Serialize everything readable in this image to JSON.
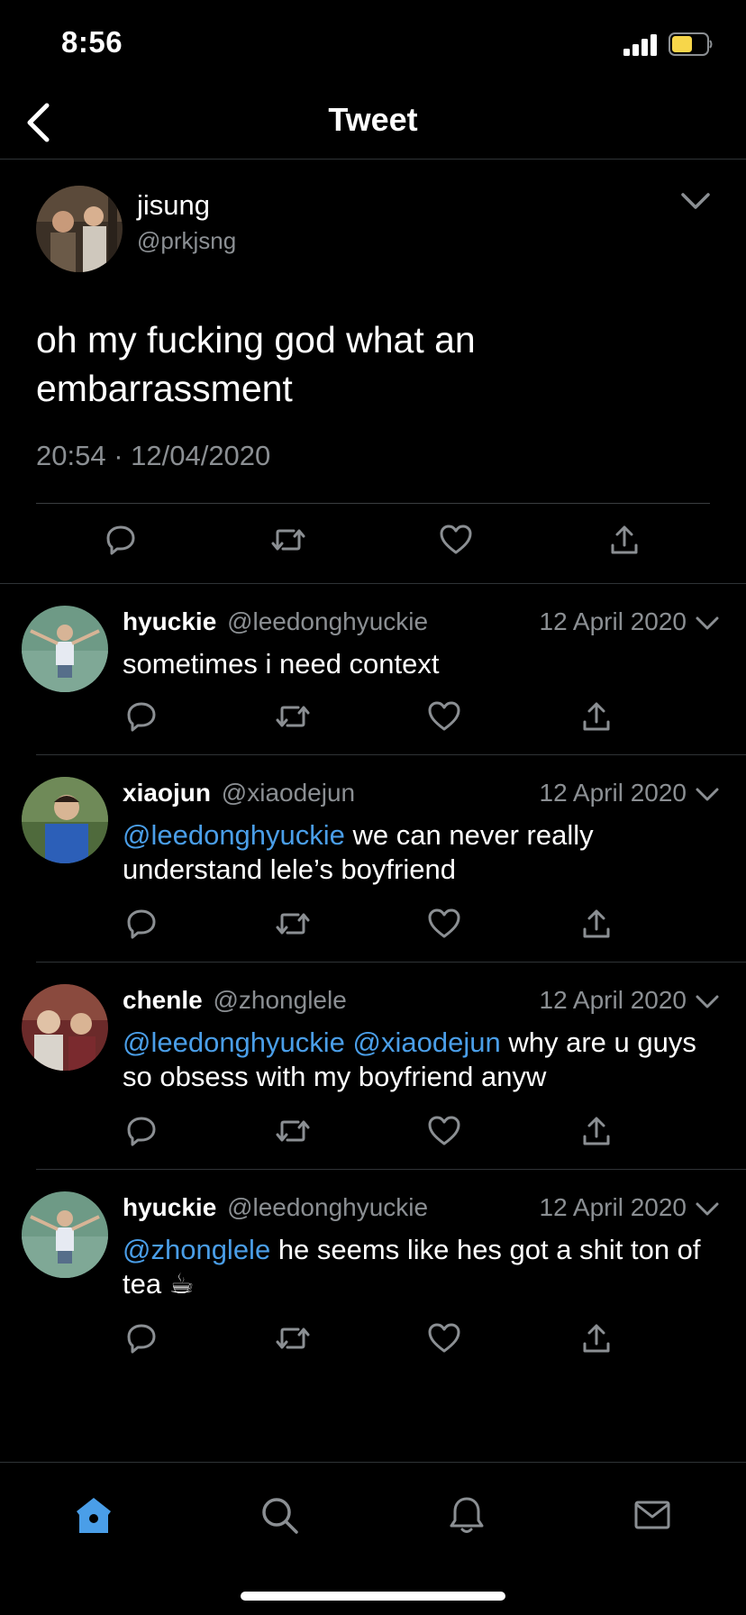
{
  "status_bar": {
    "time": "8:56"
  },
  "nav": {
    "title": "Tweet"
  },
  "main_tweet": {
    "name": "jisung",
    "handle": "@prkjsng",
    "text": "oh my fucking god what an embarrassment",
    "timestamp": "20:54 · 12/04/2020"
  },
  "replies": [
    {
      "name": "hyuckie",
      "handle": "@leedonghyuckie",
      "date": "12 April 2020",
      "mentions": "",
      "text": "sometimes i need context"
    },
    {
      "name": "xiaojun",
      "handle": "@xiaodejun",
      "date": "12 April 2020",
      "mentions": "@leedonghyuckie",
      "text": " we can never really understand lele’s boyfriend"
    },
    {
      "name": "chenle",
      "handle": "@zhonglele",
      "date": "12 April 2020",
      "mentions": "@leedonghyuckie @xiaodejun",
      "text": " why are u guys so obsess with my boyfriend anyw"
    },
    {
      "name": "hyuckie",
      "handle": "@leedonghyuckie",
      "date": "12 April 2020",
      "mentions": "@zhonglele",
      "text": " he seems like hes got a shit ton of tea ☕"
    }
  ],
  "icons": {
    "reply": "reply-icon",
    "retweet": "retweet-icon",
    "like": "heart-icon",
    "share": "share-icon",
    "tabs": [
      "home-icon",
      "search-icon",
      "bell-icon",
      "mail-icon"
    ]
  },
  "colors": {
    "accent": "#4a9ee8",
    "background": "#000000",
    "muted": "#8b8f93",
    "battery": "#f7d64a"
  }
}
